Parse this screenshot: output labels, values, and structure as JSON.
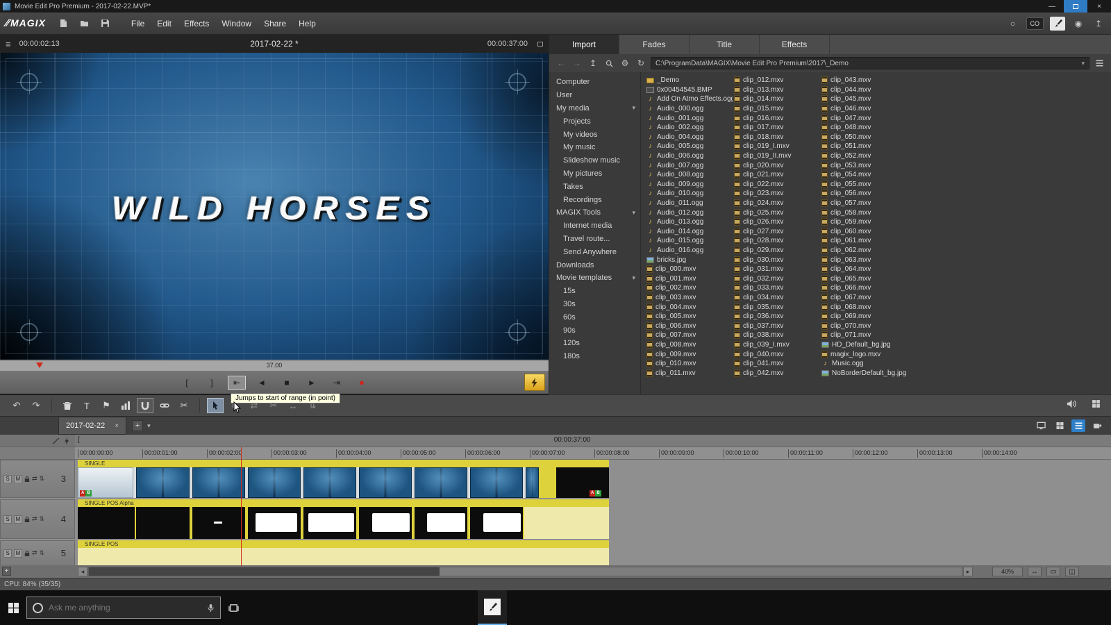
{
  "window": {
    "title": "Movie Edit Pro Premium - 2017-02-22.MVP*",
    "controls": [
      {
        "name": "minimize",
        "glyph": "—"
      },
      {
        "name": "maximize",
        "box": true,
        "active": true
      },
      {
        "name": "close",
        "glyph": "×"
      }
    ]
  },
  "glyphs": {
    "hamburger": "≡",
    "dropdown": "▾",
    "track_fx": "⇄",
    "track_size": "⇅"
  },
  "menubar": {
    "brand_mark": "∕∕",
    "brand": "MAGIX",
    "menus": [
      "File",
      "Edit",
      "Effects",
      "Window",
      "Share",
      "Help"
    ],
    "left_icons": [
      {
        "name": "new-project-icon",
        "icon": "svg:page"
      },
      {
        "name": "open-project-icon",
        "icon": "svg:folder"
      },
      {
        "name": "save-project-icon",
        "icon": "svg:floppy"
      }
    ],
    "right_icons": [
      {
        "name": "status-circle-icon",
        "glyph": "○"
      },
      {
        "name": "co-badge",
        "label": "CO"
      },
      {
        "name": "design-tools-icon",
        "icon": "svg:brush",
        "light": true
      },
      {
        "name": "record-sphere-icon",
        "glyph": "◉"
      },
      {
        "name": "export-icon",
        "glyph": "↥"
      }
    ]
  },
  "preview": {
    "tc_left": "00:00:02:13",
    "project_title": "2017-02-22 *",
    "tc_right": "00:00:37:00",
    "overlay_title": "WILD HORSES",
    "scrub_label": "37.00"
  },
  "transport": {
    "tooltip": "Jumps to start of range (in point)",
    "buttons": [
      {
        "name": "mark-in-button",
        "glyph": "["
      },
      {
        "name": "mark-out-button",
        "glyph": "]"
      },
      {
        "name": "jump-range-start-button",
        "glyph": "⇤",
        "active": true
      },
      {
        "name": "previous-frame-button",
        "glyph": "◄"
      },
      {
        "name": "stop-button",
        "glyph": "■"
      },
      {
        "name": "play-button",
        "glyph": "►"
      },
      {
        "name": "jump-range-end-button",
        "glyph": "⇥"
      },
      {
        "name": "record-button",
        "glyph": "●",
        "record": true
      }
    ]
  },
  "toolbar": {
    "items": [
      {
        "name": "undo-button",
        "glyph": "↶"
      },
      {
        "name": "redo-button",
        "glyph": "↷"
      },
      {
        "sep": true
      },
      {
        "name": "delete-object-button",
        "icon": "svg:trash"
      },
      {
        "name": "add-title-button",
        "glyph": "T"
      },
      {
        "name": "set-marker-button",
        "glyph": "⚑"
      },
      {
        "name": "waveform-display-button",
        "icon": "svg:bars"
      },
      {
        "name": "snap-button",
        "icon": "svg:magnet",
        "boxed": true
      },
      {
        "name": "group-button",
        "icon": "svg:chain"
      },
      {
        "name": "split-button",
        "glyph": "✂"
      },
      {
        "sep": true
      },
      {
        "name": "mouse-mode-select-button",
        "icon": "svg:pointer",
        "active": true
      },
      {
        "name": "mouse-mode-2-button",
        "icon": "svg:pointer",
        "dim": true
      },
      {
        "name": "mouse-mode-3-button",
        "glyph": "⇄",
        "dim": true
      },
      {
        "name": "mouse-mode-4-button",
        "glyph": "✂",
        "dim": true
      },
      {
        "name": "mouse-mode-5-button",
        "glyph": "↔",
        "dim": true
      },
      {
        "name": "mouse-mode-6-button",
        "glyph": "⇅",
        "dim": true
      }
    ]
  },
  "mediapool": {
    "tabs": [
      {
        "label": "Import",
        "active": true
      },
      {
        "label": "Fades"
      },
      {
        "label": "Title"
      },
      {
        "label": "Effects"
      }
    ],
    "pathbar": {
      "path": "C:\\ProgramData\\MAGIX\\Movie Edit Pro Premium\\2017\\_Demo",
      "icons": [
        {
          "name": "back-icon",
          "glyph": "←",
          "dim": true
        },
        {
          "name": "forward-icon",
          "glyph": "→",
          "dim": true
        },
        {
          "name": "up-level-icon",
          "glyph": "↥"
        },
        {
          "name": "search-icon",
          "icon": "svg:search"
        },
        {
          "name": "options-gear-icon",
          "glyph": "⚙"
        },
        {
          "name": "refresh-icon",
          "glyph": "↻"
        }
      ]
    },
    "nav": [
      {
        "label": "Computer",
        "indent": 0
      },
      {
        "label": "User",
        "indent": 0
      },
      {
        "label": "My media",
        "indent": 0,
        "expanded": true
      },
      {
        "label": "Projects",
        "indent": 1
      },
      {
        "label": "My videos",
        "indent": 1
      },
      {
        "label": "My music",
        "indent": 1
      },
      {
        "label": "Slideshow music",
        "indent": 1
      },
      {
        "label": "My pictures",
        "indent": 1
      },
      {
        "label": "Takes",
        "indent": 1
      },
      {
        "label": "Recordings",
        "indent": 1
      },
      {
        "label": "MAGIX Tools",
        "indent": 0,
        "expanded": true
      },
      {
        "label": "Internet media",
        "indent": 1
      },
      {
        "label": "Travel route...",
        "indent": 1
      },
      {
        "label": "Send Anywhere",
        "indent": 1
      },
      {
        "label": "Downloads",
        "indent": 0
      },
      {
        "label": "Movie templates",
        "indent": 0,
        "expanded": true
      },
      {
        "label": "15s",
        "indent": 1
      },
      {
        "label": "30s",
        "indent": 1
      },
      {
        "label": "60s",
        "indent": 1
      },
      {
        "label": "90s",
        "indent": 1
      },
      {
        "label": "120s",
        "indent": 1
      },
      {
        "label": "180s",
        "indent": 1
      }
    ],
    "columns": [
      [
        "_Demo",
        "0x00454545.BMP",
        "Add On Atmo Effects.ogg",
        "Audio_000.ogg",
        "Audio_001.ogg",
        "Audio_002.ogg",
        "Audio_004.ogg",
        "Audio_005.ogg",
        "Audio_006.ogg",
        "Audio_007.ogg",
        "Audio_008.ogg",
        "Audio_009.ogg",
        "Audio_010.ogg",
        "Audio_011.ogg",
        "Audio_012.ogg",
        "Audio_013.ogg",
        "Audio_014.ogg",
        "Audio_015.ogg",
        "Audio_016.ogg",
        "bricks.jpg",
        "clip_000.mxv",
        "clip_001.mxv",
        "clip_002.mxv",
        "clip_003.mxv",
        "clip_004.mxv",
        "clip_005.mxv",
        "clip_006.mxv",
        "clip_007.mxv",
        "clip_008.mxv",
        "clip_009.mxv",
        "clip_010.mxv",
        "clip_011.mxv"
      ],
      [
        "clip_012.mxv",
        "clip_013.mxv",
        "clip_014.mxv",
        "clip_015.mxv",
        "clip_016.mxv",
        "clip_017.mxv",
        "clip_018.mxv",
        "clip_019_I.mxv",
        "clip_019_II.mxv",
        "clip_020.mxv",
        "clip_021.mxv",
        "clip_022.mxv",
        "clip_023.mxv",
        "clip_024.mxv",
        "clip_025.mxv",
        "clip_026.mxv",
        "clip_027.mxv",
        "clip_028.mxv",
        "clip_029.mxv",
        "clip_030.mxv",
        "clip_031.mxv",
        "clip_032.mxv",
        "clip_033.mxv",
        "clip_034.mxv",
        "clip_035.mxv",
        "clip_036.mxv",
        "clip_037.mxv",
        "clip_038.mxv",
        "clip_039_I.mxv",
        "clip_040.mxv",
        "clip_041.mxv",
        "clip_042.mxv"
      ],
      [
        "clip_043.mxv",
        "clip_044.mxv",
        "clip_045.mxv",
        "clip_046.mxv",
        "clip_047.mxv",
        "clip_048.mxv",
        "clip_050.mxv",
        "clip_051.mxv",
        "clip_052.mxv",
        "clip_053.mxv",
        "clip_054.mxv",
        "clip_055.mxv",
        "clip_056.mxv",
        "clip_057.mxv",
        "clip_058.mxv",
        "clip_059.mxv",
        "clip_060.mxv",
        "clip_061.mxv",
        "clip_062.mxv",
        "clip_063.mxv",
        "clip_064.mxv",
        "clip_065.mxv",
        "clip_066.mxv",
        "clip_067.mxv",
        "clip_068.mxv",
        "clip_069.mxv",
        "clip_070.mxv",
        "clip_071.mxv",
        "HD_Default_bg.jpg",
        "magix_logo.mxv",
        "Music.ogg",
        "NoBorderDefault_bg.jpg"
      ]
    ]
  },
  "timeline": {
    "tab_label": "2017-02-22",
    "close_glyph": "×",
    "add_glyph": "+",
    "in_marker": "[",
    "range_display": "00:00:37:00",
    "ruler_ticks": [
      "00:00:00:00",
      "00:00:01:00",
      "00:00:02:00",
      "00:00:03:00",
      "00:00:04:00",
      "00:00:05:00",
      "00:00:06:00",
      "00:00:07:00",
      "00:00:08:00",
      "00:00:09:00",
      "00:00:10:00",
      "00:00:11:00",
      "00:00:12:00",
      "00:00:13:00",
      "00:00:14:00"
    ],
    "solo_label": "S",
    "mute_label": "M",
    "tracks": [
      {
        "number": "3",
        "banner": "SINGLE"
      },
      {
        "number": "4",
        "banner": "SINGLE POS Alpha"
      },
      {
        "number": "5",
        "banner": "SINGLE POS"
      }
    ],
    "ab_badge": {
      "a": "A",
      "b": "B"
    },
    "view_icons": [
      {
        "name": "preview-monitor-view-icon",
        "icon": "svg:monitor"
      },
      {
        "name": "storyboard-view-icon",
        "icon": "svg:grid4"
      },
      {
        "name": "timeline-view-icon",
        "icon": "svg:listview",
        "active": true
      },
      {
        "name": "multicam-view-icon",
        "icon": "svg:camera"
      }
    ]
  },
  "scrollbar": {
    "add_track_glyph": "+",
    "left_glyph": "◂",
    "right_glyph": "▸",
    "zoom": "40%",
    "controls": [
      {
        "name": "zoom-horizontal-icon",
        "glyph": "↔"
      },
      {
        "name": "zoom-preset-1-icon",
        "glyph": "▭"
      },
      {
        "name": "zoom-preset-2-icon",
        "glyph": "◫"
      }
    ]
  },
  "statusbar": {
    "cpu": "CPU: 84% (35/35)"
  },
  "taskbar": {
    "search_placeholder": "Ask me anything"
  }
}
